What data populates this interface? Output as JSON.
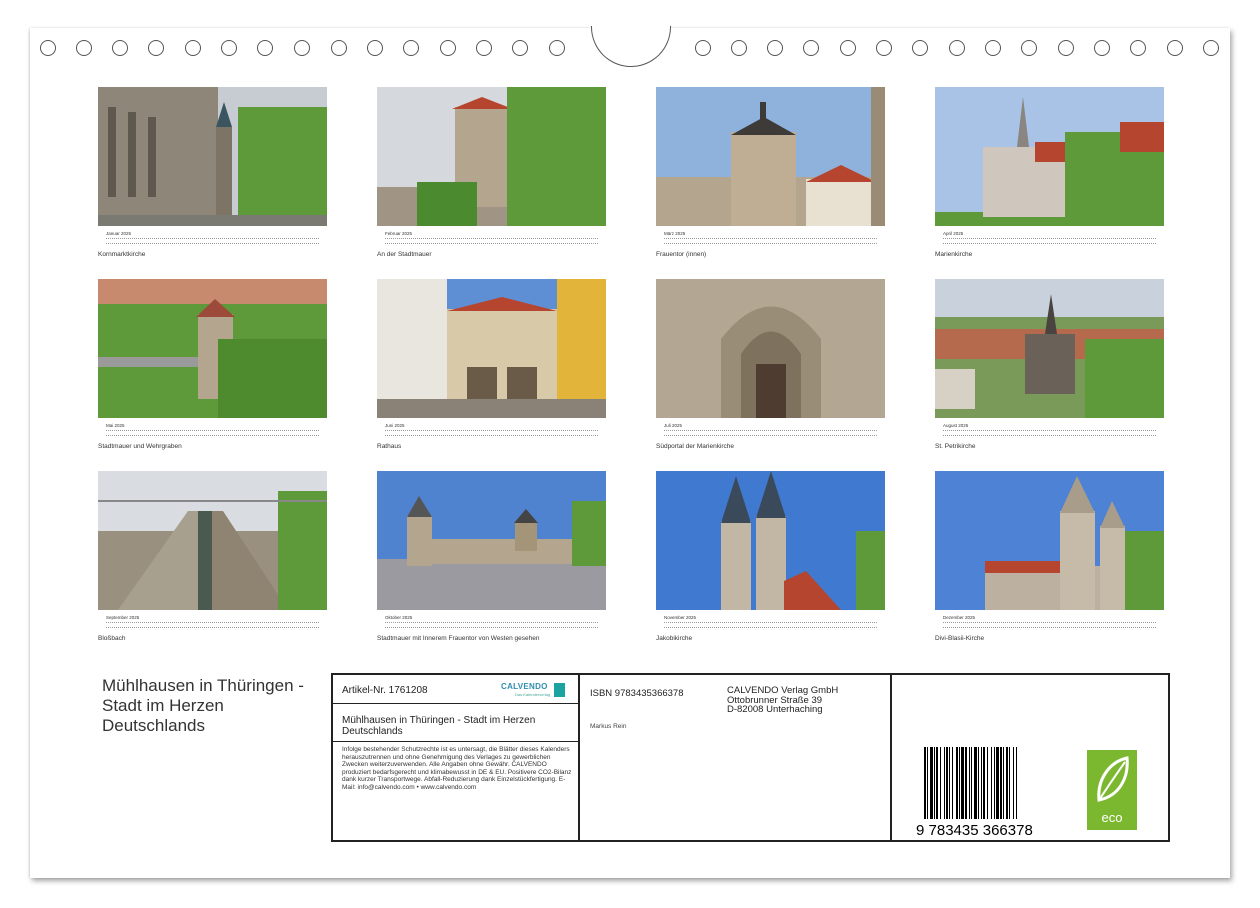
{
  "months": [
    {
      "id": "jan",
      "label": "Januar 2025",
      "caption": "Kornmarktkirche"
    },
    {
      "id": "feb",
      "label": "Februar 2025",
      "caption": "An der Stadtmauer"
    },
    {
      "id": "mar",
      "label": "März 2025",
      "caption": "Frauentor (innen)"
    },
    {
      "id": "apr",
      "label": "April 2025",
      "caption": "Marienkirche"
    },
    {
      "id": "mai",
      "label": "Mai 2025",
      "caption": "Stadtmauer und Wehrgraben"
    },
    {
      "id": "jun",
      "label": "Juni 2025",
      "caption": "Rathaus"
    },
    {
      "id": "jul",
      "label": "Juli 2025",
      "caption": "Südportal der Marienkirche"
    },
    {
      "id": "aug",
      "label": "August 2025",
      "caption": "St. Petrikirche"
    },
    {
      "id": "sep",
      "label": "September 2025",
      "caption": "Bloßbach"
    },
    {
      "id": "okt",
      "label": "Oktober 2025",
      "caption": "Stadtmauer mit Innerem Frauentor von Westen gesehen"
    },
    {
      "id": "nov",
      "label": "November 2025",
      "caption": "Jakobikirche"
    },
    {
      "id": "dez",
      "label": "Dezember 2025",
      "caption": "Divi-Blasii-Kirche"
    }
  ],
  "side_title": "Mühlhausen in Thüringen - Stadt im Herzen Deutschlands",
  "info": {
    "artikel": "Artikel-Nr. 1761208",
    "logo_text": "CALVENDO",
    "logo_sub": "Das Kalenderverlag",
    "title": "Mühlhausen in Thüringen - Stadt im Herzen Deutschlands",
    "fine_print": "Infolge bestehender Schutzrechte ist es untersagt, die Blätter dieses Kalenders herauszutrennen und ohne Genehmigung des Verlages zu gewerblichen Zwecken weiterzuverwenden. Alle Angaben ohne Gewähr. CALVENDO produziert bedarfsgerecht und klimabewusst in DE & EU. Positivere CO2-Bilanz dank kurzer Transportwege. Abfall-Reduzierung dank Einzelstückfertigung. E-Mail: info@calvendo.com • www.calvendo.com",
    "isbn": "ISBN 9783435366378",
    "author": "Markus Rein",
    "publisher": [
      "CALVENDO Verlag GmbH",
      "Ottobrunner Straße 39",
      "D-82008 Unterhaching"
    ],
    "barcode_digits": "9 783435 366378",
    "eco_label": "eco"
  },
  "colors": {
    "sky": "#7fa9d8",
    "stone": "#b8a48a",
    "green": "#5f9a3a",
    "roof": "#b5452e",
    "eco": "#7cb82f",
    "calvendo": "#2f8fae"
  }
}
